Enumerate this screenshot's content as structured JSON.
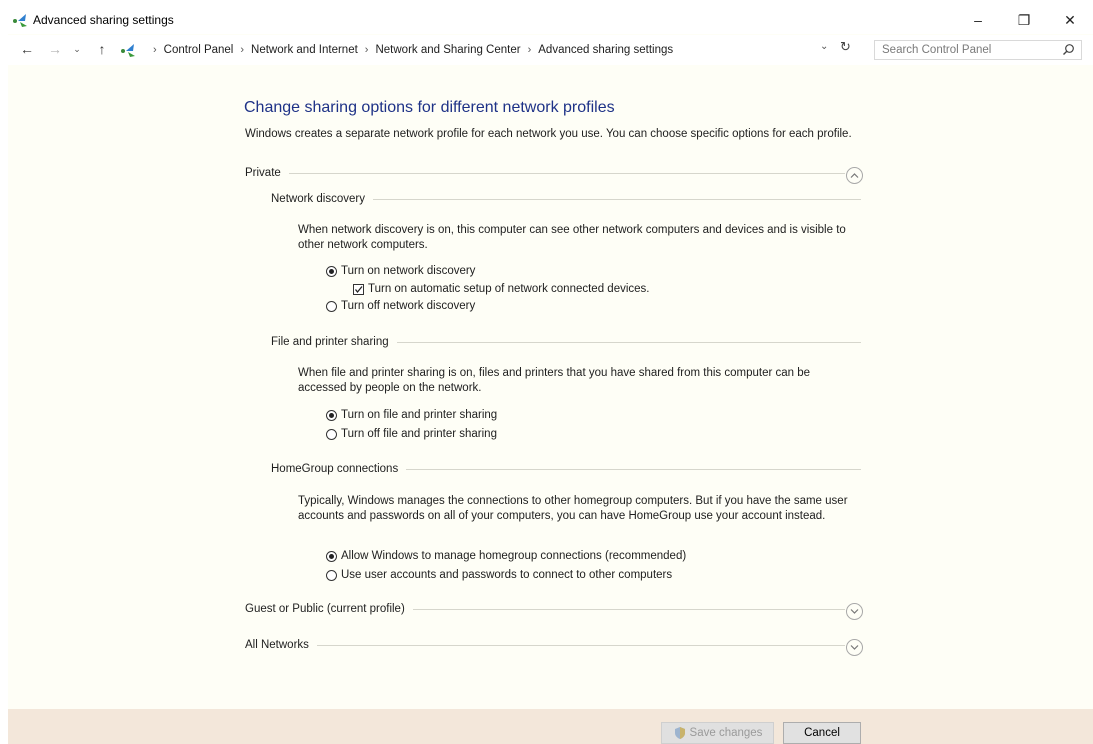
{
  "window": {
    "title": "Advanced sharing settings"
  },
  "title_buttons": {
    "minimize": "–",
    "maximize": "❐",
    "close": "✕"
  },
  "nav": {
    "back": "←",
    "forward": "→",
    "recent": "⌄",
    "up": "↑",
    "dropdown": "⌄",
    "refresh": "↻"
  },
  "breadcrumb": [
    "Control Panel",
    "Network and Internet",
    "Network and Sharing Center",
    "Advanced sharing settings"
  ],
  "breadcrumb_separator": "›",
  "search": {
    "placeholder": "Search Control Panel"
  },
  "main": {
    "heading": "Change sharing options for different network profiles",
    "intro": "Windows creates a separate network profile for each network you use. You can choose specific options for each profile.",
    "profiles": {
      "private": "Private",
      "guest_public": "Guest or Public (current profile)",
      "all_networks": "All Networks"
    },
    "network_discovery": {
      "title": "Network discovery",
      "description": "When network discovery is on, this computer can see other network computers and devices and is visible to other network computers.",
      "option_on": "Turn on network discovery",
      "option_auto": "Turn on automatic setup of network connected devices.",
      "option_off": "Turn off network discovery",
      "selected": "on",
      "auto_checked": true
    },
    "file_printer_sharing": {
      "title": "File and printer sharing",
      "description": "When file and printer sharing is on, files and printers that you have shared from this computer can be accessed by people on the network.",
      "option_on": "Turn on file and printer sharing",
      "option_off": "Turn off file and printer sharing",
      "selected": "on"
    },
    "homegroup": {
      "title": "HomeGroup connections",
      "description": "Typically, Windows manages the connections to other homegroup computers. But if you have the same user accounts and passwords on all of your computers, you can have HomeGroup use your account instead.",
      "option_windows": "Allow Windows to manage homegroup connections (recommended)",
      "option_user": "Use user accounts and passwords to connect to other computers",
      "selected": "windows"
    }
  },
  "footer": {
    "save_label": "Save changes",
    "cancel_label": "Cancel"
  },
  "colors": {
    "heading": "#1e3287",
    "content_bg": "#fefef6",
    "footer_bg": "#f3e7da"
  }
}
